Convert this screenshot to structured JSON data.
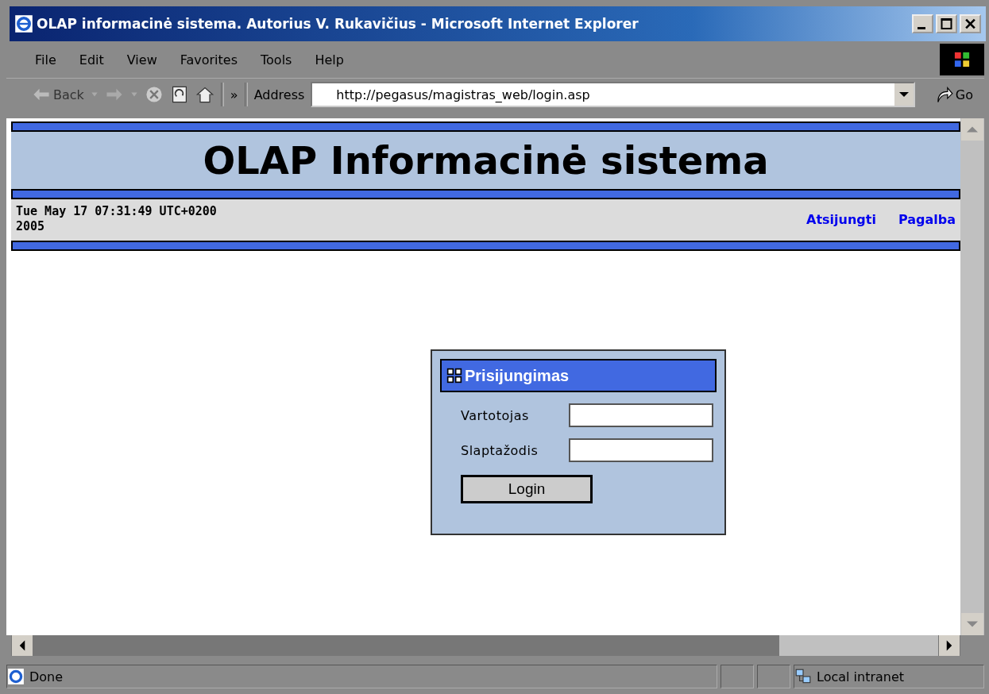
{
  "window": {
    "title": "OLAP informacinė sistema. Autorius V. Rukavičius - Microsoft Internet Explorer"
  },
  "menu": [
    "File",
    "Edit",
    "View",
    "Favorites",
    "Tools",
    "Help"
  ],
  "toolbar": {
    "back": "Back",
    "more": "»",
    "address_label": "Address",
    "url": "http://pegasus/magistras_web/login.asp",
    "go": "Go"
  },
  "page": {
    "heading": "OLAP Informacinė sistema",
    "date": "Tue May 17 07:31:49 UTC+0200 2005",
    "links": [
      "Atsijungti",
      "Pagalba"
    ],
    "login": {
      "title": "Prisijungimas",
      "fields": [
        {
          "label": "Vartotojas"
        },
        {
          "label": "Slaptažodis"
        }
      ],
      "button": "Login"
    }
  },
  "status_bar": {
    "text": "Done",
    "zone": "Local intranet"
  }
}
